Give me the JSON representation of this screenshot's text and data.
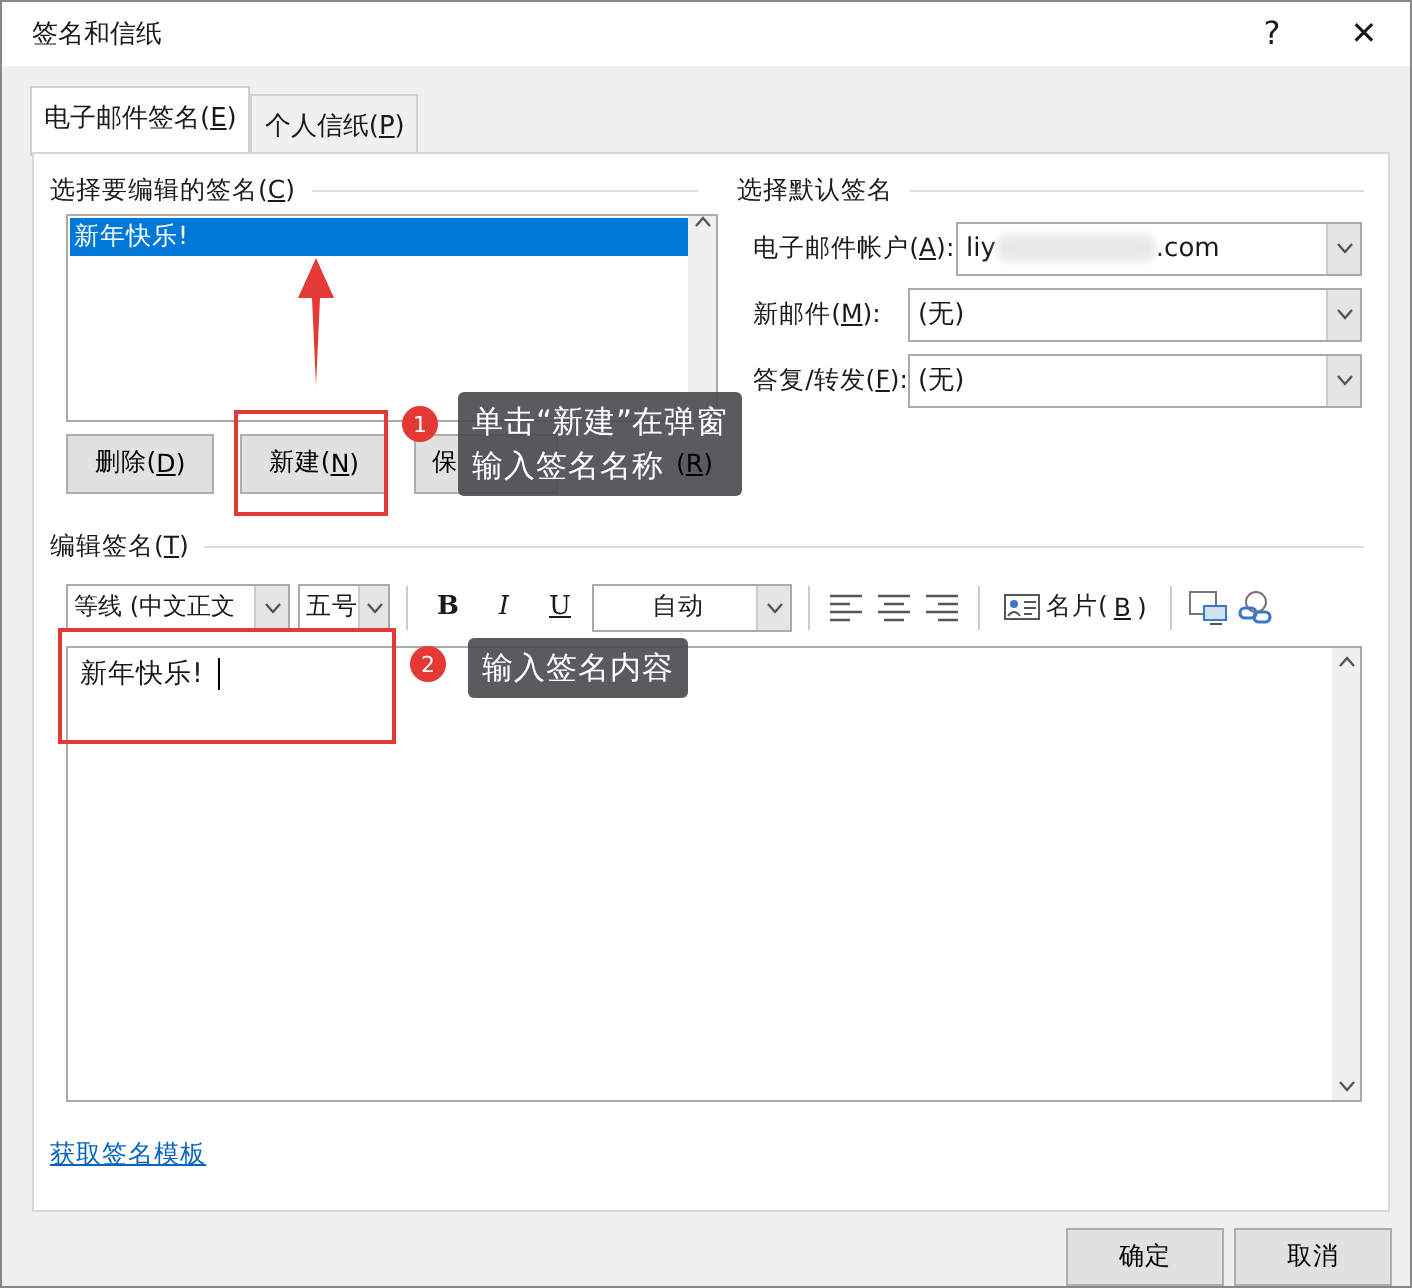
{
  "window": {
    "title": "签名和信纸",
    "help": "?",
    "close": "✕"
  },
  "tabs": [
    {
      "label": "电子邮件签名(E)",
      "selected": true
    },
    {
      "label": "个人信纸(P)",
      "selected": false
    }
  ],
  "edit_list": {
    "heading": "选择要编辑的签名(C)",
    "items": [
      {
        "label": "新年快乐!",
        "selected": true
      }
    ],
    "buttons": [
      {
        "label": "删除(D)",
        "kind": "full"
      },
      {
        "label": "新建(N)",
        "kind": "full"
      },
      {
        "label": "保",
        "kind": "start"
      },
      {
        "label": "(R)",
        "kind": "end"
      }
    ]
  },
  "defaults": {
    "heading": "选择默认签名",
    "rows": [
      {
        "label": "电子邮件帐户(A):",
        "value_start": "liy",
        "value_end": ".com",
        "blurred": true
      },
      {
        "label": "新邮件(M):",
        "value_start": "(无)",
        "blurred": false
      },
      {
        "label": "答复/转发(F):",
        "value_start": "(无)",
        "blurred": false
      }
    ]
  },
  "editor": {
    "heading": "编辑签名(T)",
    "font": "等线 (中文正文",
    "size": "五号",
    "bold": "B",
    "italic": "I",
    "underline": "U",
    "text_color": "自动",
    "card": "名片(B)",
    "content": "新年快乐!"
  },
  "template_link": "获取签名模板",
  "footer_buttons": [
    "确定",
    "取消"
  ],
  "annotations": [
    {
      "number": "1",
      "lines": [
        "单击“新建”在弹窗",
        "输入签名名称"
      ]
    },
    {
      "number": "2",
      "lines": [
        "输入签名内容"
      ]
    }
  ]
}
